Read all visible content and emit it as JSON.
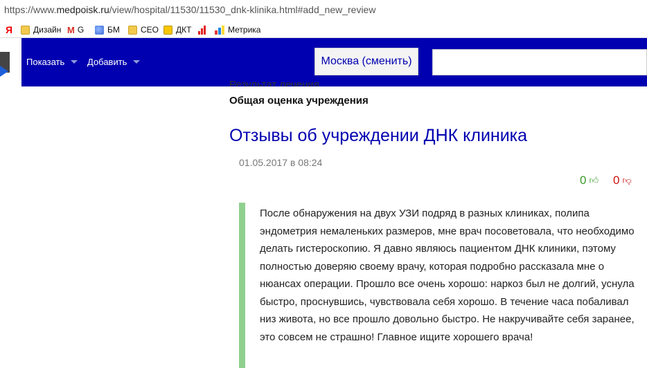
{
  "browser": {
    "url_prefix": "https://www.",
    "url_host": "medpoisk.ru",
    "url_path": "/view/hospital/11530/11530_dnk-klinika.html#add_new_review"
  },
  "bookmarks": {
    "yandex": "Я",
    "design": "Дизайн",
    "gmail": "M",
    "g": "G",
    "bm": "БМ",
    "seo": "СЕО",
    "dkt": "ДКТ",
    "metrika": "Метрика"
  },
  "nav": {
    "show": "Показать",
    "add": "Добавить",
    "city": "Москва (сменить)",
    "search_placeholder": ""
  },
  "content": {
    "cut_text": "Результат лечения",
    "subhead": "Общая оценка учреждения",
    "title": "Отзывы об учреждении ДНК клиника"
  },
  "review": {
    "date": "01.05.2017 в 08:24",
    "votes_up": "0",
    "votes_down": "0",
    "text": "После обнаружения на двух УЗИ подряд в разных клиниках, полипа эндометрия немаленьких размеров, мне врач посоветовала, что необходимо делать гистероскопию. Я давно являюсь пациентом ДНК клиники, пэтому полностью доверяю своему врачу, которая подробно рассказала мне о нюансах операции. Прошло все очень хорошо: наркоз был не долгий, уснула быстро, проснувшись, чувствовала себя хорошо. В течение часа побаливал низ живота, но все прошло довольно быстро. Не накручивайте себя заранее, это совсем не страшно! Главное ищите хорошего врача!"
  },
  "colors": {
    "nav_bg": "#0000b0",
    "review_border": "#8fd08f",
    "vote_up": "#3a9a2a",
    "vote_down": "#cc1111"
  }
}
